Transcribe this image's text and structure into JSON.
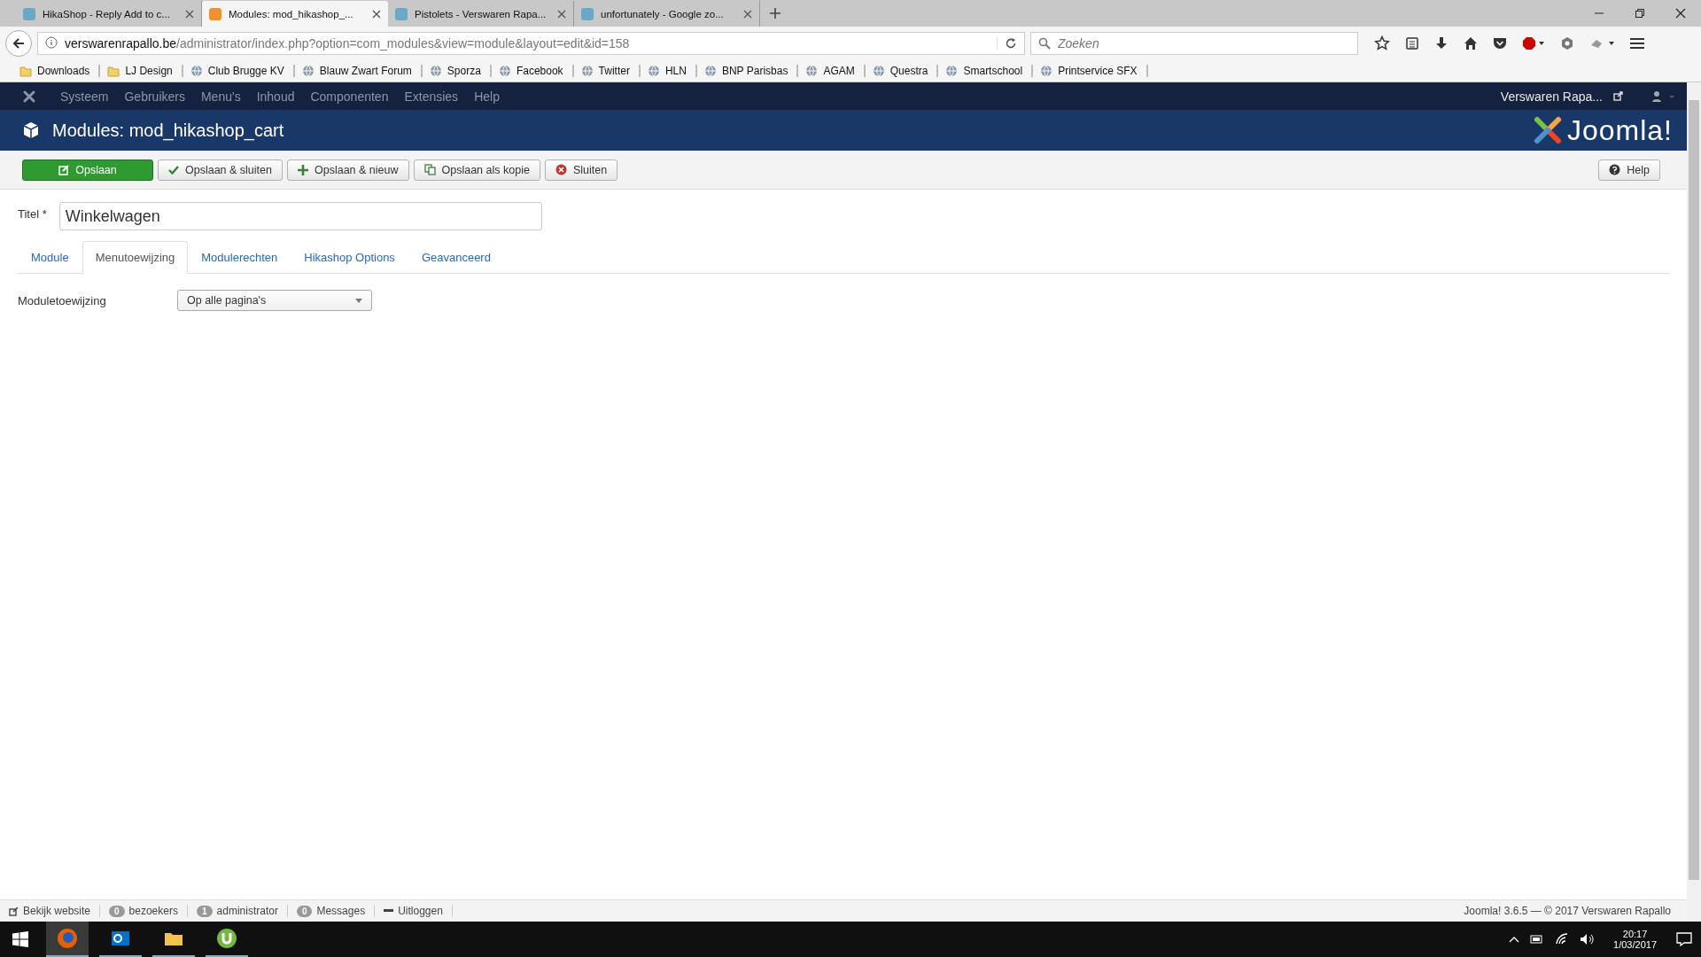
{
  "browser": {
    "tabs": [
      {
        "title": "HikaShop - Reply Add to c...",
        "selected": false
      },
      {
        "title": "Modules: mod_hikashop_...",
        "selected": true
      },
      {
        "title": "Pistolets - Verswaren Rapa...",
        "selected": false
      },
      {
        "title": "unfortunately - Google zo...",
        "selected": false
      }
    ],
    "url": {
      "host": "verswarenrapallo.be",
      "path": "/administrator/index.php?option=com_modules&view=module&layout=edit&id=158"
    },
    "search": {
      "placeholder": "Zoeken"
    },
    "bookmarks": [
      {
        "label": "Downloads",
        "kind": "folder"
      },
      {
        "label": "LJ Design",
        "kind": "folder"
      },
      {
        "label": "Club Brugge KV",
        "kind": "site"
      },
      {
        "label": "Blauw Zwart Forum",
        "kind": "site"
      },
      {
        "label": "Sporza",
        "kind": "site"
      },
      {
        "label": "Facebook",
        "kind": "site"
      },
      {
        "label": "Twitter",
        "kind": "site"
      },
      {
        "label": "HLN",
        "kind": "site"
      },
      {
        "label": "BNP Parisbas",
        "kind": "site"
      },
      {
        "label": "AGAM",
        "kind": "site"
      },
      {
        "label": "Questra",
        "kind": "site"
      },
      {
        "label": "Smartschool",
        "kind": "site"
      },
      {
        "label": "Printservice SFX",
        "kind": "site"
      }
    ]
  },
  "admin_menu": {
    "items": [
      "Systeem",
      "Gebruikers",
      "Menu's",
      "Inhoud",
      "Componenten",
      "Extensies",
      "Help"
    ],
    "site_link": "Verswaren Rapa..."
  },
  "header": {
    "title": "Modules: mod_hikashop_cart",
    "brand": "Joomla!"
  },
  "toolbar": {
    "buttons": [
      {
        "label": "Opslaan",
        "kind": "save"
      },
      {
        "label": "Opslaan & sluiten",
        "kind": "save-close"
      },
      {
        "label": "Opslaan & nieuw",
        "kind": "save-new"
      },
      {
        "label": "Opslaan als kopie",
        "kind": "save-copy"
      },
      {
        "label": "Sluiten",
        "kind": "close"
      }
    ],
    "help": "Help"
  },
  "form": {
    "title_field": {
      "label": "Titel",
      "required": "*",
      "value": "Winkelwagen"
    },
    "tabs": [
      {
        "label": "Module",
        "selected": false
      },
      {
        "label": "Menutoewijzing",
        "selected": true
      },
      {
        "label": "Modulerechten",
        "selected": false
      },
      {
        "label": "Hikashop Options",
        "selected": false
      },
      {
        "label": "Geavanceerd",
        "selected": false
      }
    ],
    "fields": [
      {
        "label": "Moduletoewijzing",
        "value": "Op alle pagina's"
      }
    ]
  },
  "status_bar": {
    "items": [
      {
        "kind": "link",
        "label": "Bekijk website"
      },
      {
        "kind": "count",
        "count": "0",
        "label": "bezoekers"
      },
      {
        "kind": "count",
        "count": "1",
        "label": "administrator"
      },
      {
        "kind": "count",
        "count": "0",
        "label": "Messages"
      },
      {
        "kind": "logout",
        "label": "Uitloggen"
      }
    ],
    "version": "Joomla! 3.6.5 — © 2017 Verswaren Rapallo"
  },
  "taskbar": {
    "time": "20:17",
    "date": "1/03/2017"
  }
}
